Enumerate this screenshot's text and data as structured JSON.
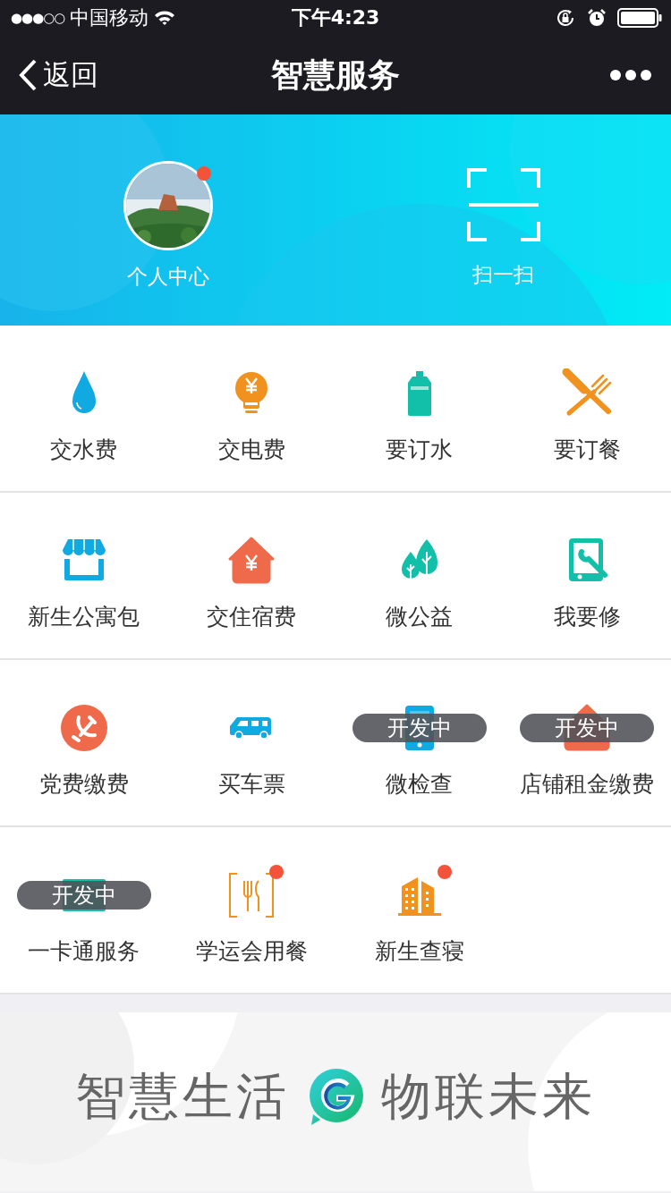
{
  "status_bar": {
    "signal": "●●●○○",
    "carrier": "中国移动",
    "time": "下午4:23"
  },
  "nav": {
    "back": "返回",
    "title": "智慧服务"
  },
  "header": {
    "profile": {
      "label": "个人中心",
      "notification": true
    },
    "scan": {
      "label": "扫一扫"
    }
  },
  "services": [
    {
      "kind": "drop",
      "label": "交水费",
      "notification": false
    },
    {
      "kind": "bulb",
      "label": "交电费",
      "notification": false
    },
    {
      "kind": "bottle",
      "label": "要订水",
      "notification": false
    },
    {
      "kind": "utensils",
      "label": "要订餐",
      "notification": false
    },
    {
      "kind": "store",
      "label": "新生公寓包",
      "notification": false
    },
    {
      "kind": "house",
      "label": "交住宿费",
      "notification": false
    },
    {
      "kind": "trees",
      "label": "微公益",
      "notification": false
    },
    {
      "kind": "repair",
      "label": "我要修",
      "notification": false
    },
    {
      "kind": "emblem",
      "label": "党费缴费",
      "notification": false
    },
    {
      "kind": "car",
      "label": "买车票",
      "notification": false
    },
    {
      "kind": "tablet",
      "label": "微检查",
      "badge": "开发中",
      "notification": false
    },
    {
      "kind": "shop",
      "label": "店铺租金缴费",
      "badge": "开发中",
      "notification": false
    },
    {
      "kind": "card",
      "label": "一卡通服务",
      "badge": "开发中",
      "notification": false
    },
    {
      "kind": "meal",
      "label": "学运会用餐",
      "notification": true
    },
    {
      "kind": "building",
      "label": "新生查寝",
      "notification": true
    }
  ],
  "banner": {
    "left": "智慧生活",
    "right": "物联未来"
  }
}
